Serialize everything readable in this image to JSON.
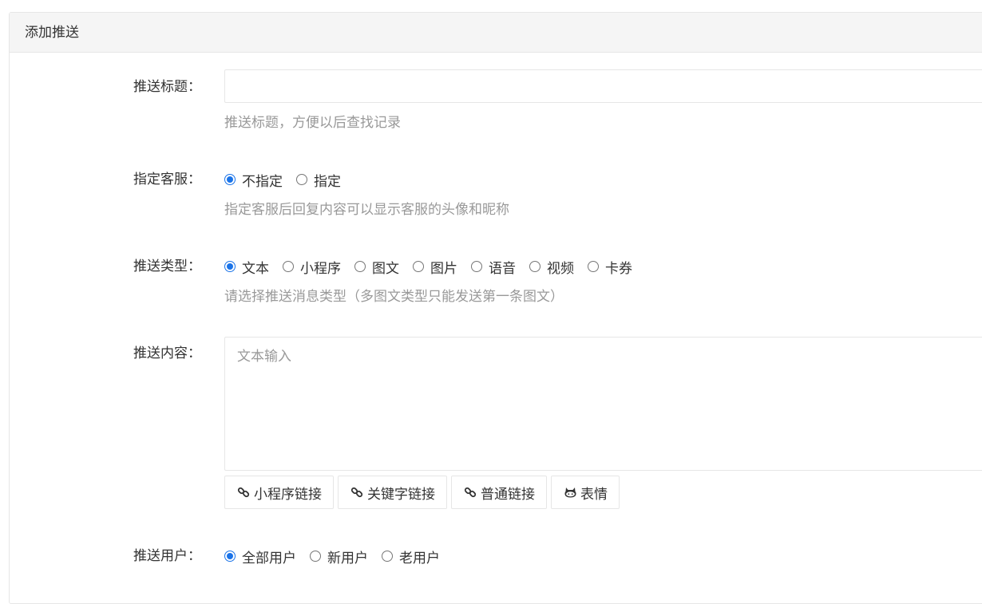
{
  "panel": {
    "title": "添加推送"
  },
  "form": {
    "push_title": {
      "label": "推送标题：",
      "value": "",
      "placeholder": "",
      "help": "推送标题，方便以后查找记录"
    },
    "assign_service": {
      "label": "指定客服：",
      "options": [
        {
          "label": "不指定",
          "checked": true
        },
        {
          "label": "指定",
          "checked": false
        }
      ],
      "help": "指定客服后回复内容可以显示客服的头像和昵称"
    },
    "push_type": {
      "label": "推送类型：",
      "options": [
        {
          "label": "文本",
          "checked": true
        },
        {
          "label": "小程序",
          "checked": false
        },
        {
          "label": "图文",
          "checked": false
        },
        {
          "label": "图片",
          "checked": false
        },
        {
          "label": "语音",
          "checked": false
        },
        {
          "label": "视频",
          "checked": false
        },
        {
          "label": "卡券",
          "checked": false
        }
      ],
      "help": "请选择推送消息类型（多图文类型只能发送第一条图文）"
    },
    "push_content": {
      "label": "推送内容：",
      "value": "",
      "placeholder": "文本输入",
      "buttons": [
        {
          "label": "小程序链接",
          "icon": "link-icon"
        },
        {
          "label": "关键字链接",
          "icon": "link-icon"
        },
        {
          "label": "普通链接",
          "icon": "link-icon"
        },
        {
          "label": "表情",
          "icon": "github-cat-icon"
        }
      ]
    },
    "push_users": {
      "label": "推送用户：",
      "options": [
        {
          "label": "全部用户",
          "checked": true
        },
        {
          "label": "新用户",
          "checked": false
        },
        {
          "label": "老用户",
          "checked": false
        }
      ]
    }
  },
  "colors": {
    "accent": "#1a73e8",
    "border": "#e6e6e6",
    "header_bg": "#f5f5f5",
    "help_text": "#999999"
  }
}
